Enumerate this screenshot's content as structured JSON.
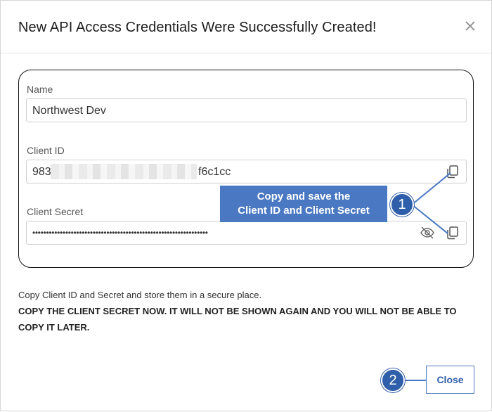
{
  "dialog": {
    "title": "New API Access Credentials Were Successfully Created!",
    "close_icon": "close-icon"
  },
  "form": {
    "name_label": "Name",
    "name_value": "Northwest Dev",
    "client_id_label": "Client ID",
    "client_id_prefix": "983",
    "client_id_suffix": "f6c1cc",
    "client_secret_label": "Client Secret",
    "client_secret_value": "••••••••••••••••••••••••••••••••••••••••••••••••••••••••••••••••",
    "copy_icon": "copy-icon",
    "visibility_icon": "eye-off-icon"
  },
  "annotations": {
    "callout_line1": "Copy and save the",
    "callout_line2": "Client ID and Client Secret",
    "step1": "1",
    "step2": "2",
    "accent": "#4a78c2"
  },
  "notice": {
    "line1": "Copy Client ID and Secret and store them in a secure place.",
    "line2": "COPY THE CLIENT SECRET NOW. IT WILL NOT BE SHOWN AGAIN AND YOU WILL NOT BE ABLE TO COPY IT LATER."
  },
  "footer": {
    "close_label": "Close"
  }
}
